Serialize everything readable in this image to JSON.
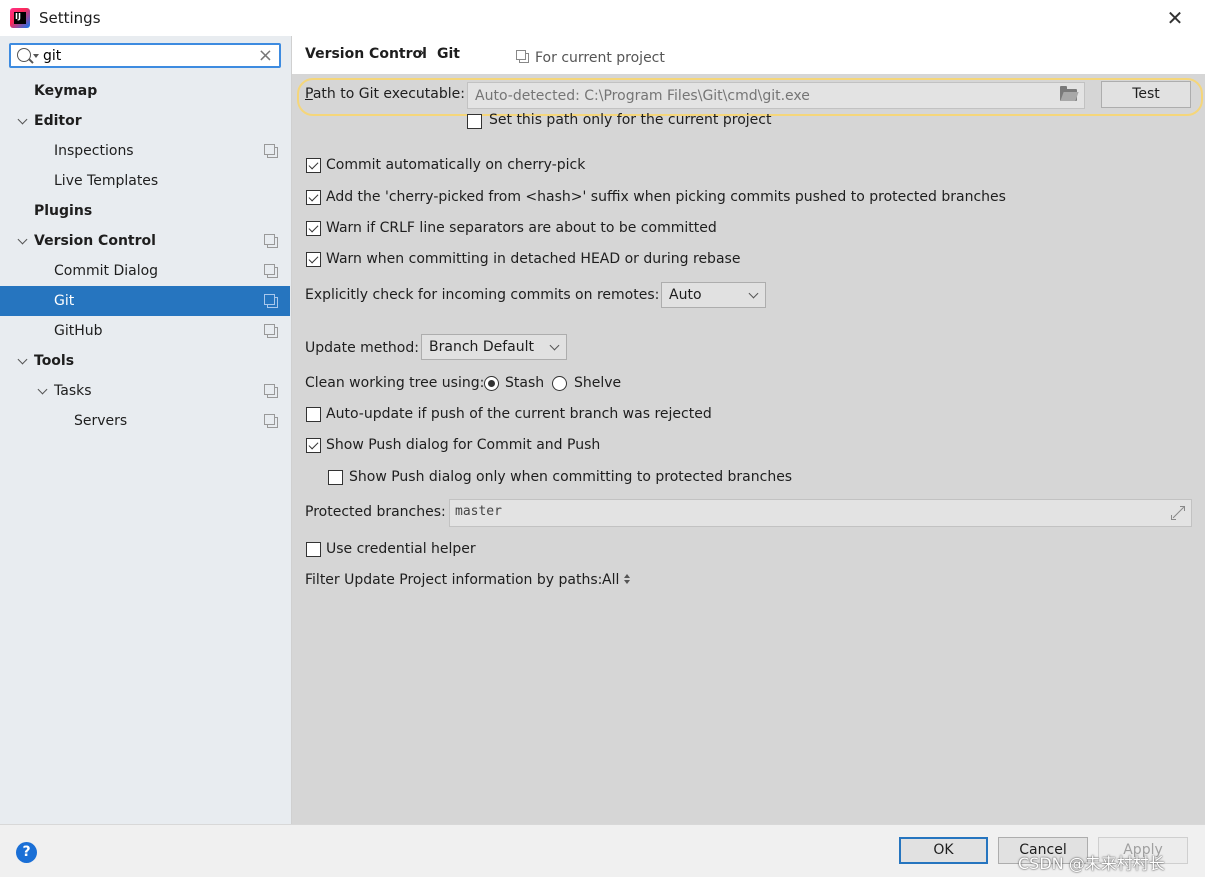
{
  "window": {
    "title": "Settings",
    "close_glyph": "✕"
  },
  "search": {
    "value": "git",
    "clear_glyph": "×"
  },
  "tree": [
    {
      "label": "Keymap"
    },
    {
      "label": "Editor"
    },
    {
      "label": "Inspections"
    },
    {
      "label": "Live Templates"
    },
    {
      "label": "Plugins"
    },
    {
      "label": "Version Control"
    },
    {
      "label": "Commit Dialog"
    },
    {
      "label": "Git"
    },
    {
      "label": "GitHub"
    },
    {
      "label": "Tools"
    },
    {
      "label": "Tasks"
    },
    {
      "label": "Servers"
    }
  ],
  "breadcrumb": {
    "parent": "Version Control",
    "separator": "›",
    "current": "Git",
    "scope": "For current project"
  },
  "git": {
    "path_label_u": "P",
    "path_label_rest": "ath to Git executable:",
    "path_placeholder": "Auto-detected: C:\\Program Files\\Git\\cmd\\git.exe",
    "test_button": "Test",
    "set_path_only": "Set this path only for the current project",
    "options": [
      "Commit automatically on cherry-pick",
      "Add the 'cherry-picked from <hash>' suffix when picking commits pushed to protected branches",
      "Warn if CRLF line separators are about to be committed",
      "Warn when committing in detached HEAD or during rebase"
    ],
    "incoming_label": "Explicitly check for incoming commits on remotes:",
    "incoming_value": "Auto",
    "update_label": "Update method:",
    "update_value": "Branch Default",
    "clean_label": "Clean working tree using:",
    "clean_stash": "Stash",
    "clean_shelve": "Shelve",
    "auto_update": "Auto-update if push of the current branch was rejected",
    "show_push": "Show Push dialog for Commit and Push",
    "show_push_protected": "Show Push dialog only when committing to protected branches",
    "protected_label": "Protected branches:",
    "protected_value": "master",
    "credential_helper": "Use credential helper",
    "filter_label": "Filter Update Project information by paths:",
    "filter_value": "All"
  },
  "footer": {
    "help": "?",
    "ok": "OK",
    "cancel": "Cancel",
    "apply": "Apply",
    "watermark": "CSDN @未来村村长"
  }
}
